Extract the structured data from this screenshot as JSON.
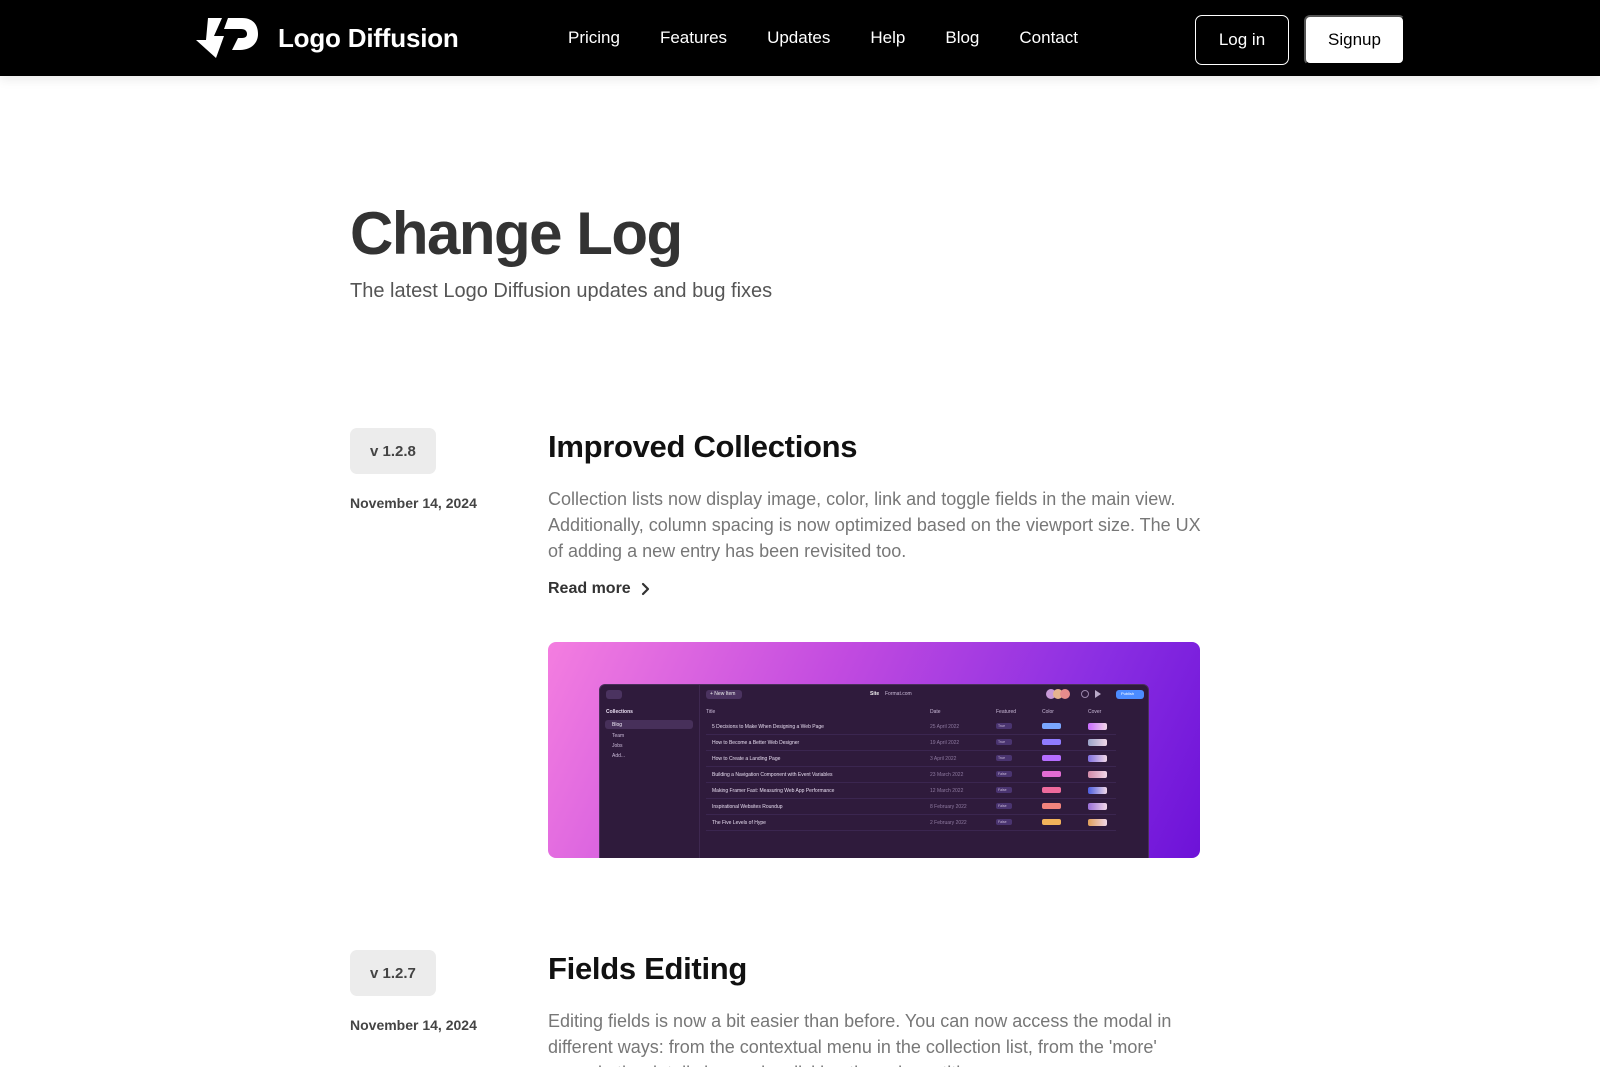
{
  "nav": {
    "brand_name": "Logo Diffusion",
    "links": [
      "Pricing",
      "Features",
      "Updates",
      "Help",
      "Blog",
      "Contact"
    ],
    "login_label": "Log in",
    "signup_label": "Signup"
  },
  "hero": {
    "title": "Change Log",
    "subtitle": "The latest Logo Diffusion updates and bug fixes"
  },
  "entries": [
    {
      "version": "v 1.2.8",
      "date": "November 14, 2024",
      "title": "Improved Collections",
      "body": "Collection lists now display image, color, link and toggle fields in the main view. Additionally, column spacing is now optimized based on the viewport size. The UX of adding a new entry has been revisited too.",
      "read_more": "Read more",
      "screenshot": {
        "toolbar": {
          "new_item": "+ New Item",
          "site": "Site",
          "format": "Format.com",
          "publish": "Publish"
        },
        "sidebar_header": "Collections",
        "sidebar_items": [
          "Blog",
          "Team",
          "Jobs",
          "Add..."
        ],
        "columns": [
          "Title",
          "Date",
          "Featured",
          "Color",
          "Cover"
        ],
        "rows": [
          {
            "title": "5 Decisions to Make When Designing a Web Page",
            "date": "25 April 2022",
            "featured": "True",
            "color": "#7aa7ff"
          },
          {
            "title": "How to Become a Better Web Designer",
            "date": "19 April 2022",
            "featured": "True",
            "color": "#8f7bff"
          },
          {
            "title": "How to Create a Landing Page",
            "date": "3 April 2022",
            "featured": "True",
            "color": "#b56dff"
          },
          {
            "title": "Building a Navigation Component with Event Variables",
            "date": "23 March 2022",
            "featured": "False",
            "color": "#e26cd3"
          },
          {
            "title": "Making Framer Fast: Measuring Web App Performance",
            "date": "12 March 2022",
            "featured": "False",
            "color": "#ee6a9c"
          },
          {
            "title": "Inspirational Websites Roundup",
            "date": "8 February 2022",
            "featured": "False",
            "color": "#f2837c"
          },
          {
            "title": "The Five Levels of Hype",
            "date": "2 February 2022",
            "featured": "False",
            "color": "#f2b35a"
          }
        ]
      }
    },
    {
      "version": "v 1.2.7",
      "date": "November 14, 2024",
      "title": "Fields Editing",
      "body": "Editing fields is now a bit easier than before. You can now access the modal in different ways: from the contextual menu in the collection list, from the 'more' menu in the detail view, or by clicking the column titles."
    }
  ],
  "colors": {
    "nav_bg": "#000000",
    "badge_bg": "#ececec",
    "gradient_start": "#f47ee0",
    "gradient_end": "#6d12d8"
  }
}
